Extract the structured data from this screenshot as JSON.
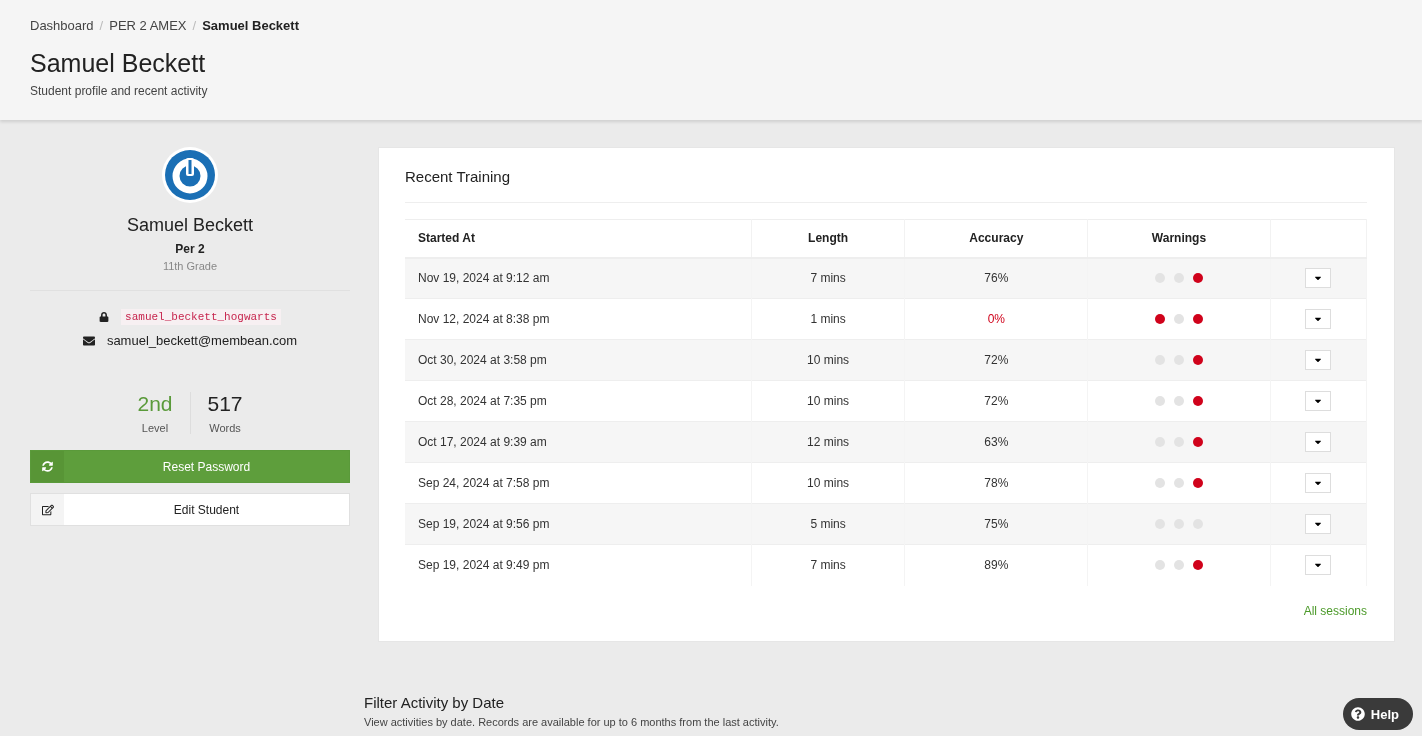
{
  "breadcrumb_separator": "/",
  "breadcrumb": [
    {
      "label": "Dashboard",
      "current": false
    },
    {
      "label": "PER 2 AMEX",
      "current": false
    },
    {
      "label": "Samuel Beckett",
      "current": true
    }
  ],
  "header": {
    "title": "Samuel Beckett",
    "subtitle": "Student profile and recent activity"
  },
  "profile": {
    "name": "Samuel Beckett",
    "class": "Per 2",
    "grade": "11th Grade",
    "username": "samuel_beckett_hogwarts",
    "email": "samuel_beckett@membean.com",
    "stats": [
      {
        "value": "2nd",
        "label": "Level",
        "highlight": true
      },
      {
        "value": "517",
        "label": "Words",
        "highlight": false
      }
    ],
    "buttons": [
      {
        "label": "Reset Password",
        "kind": "primary"
      },
      {
        "label": "Edit Student",
        "kind": "default"
      }
    ]
  },
  "training": {
    "title": "Recent Training",
    "columns": [
      "Started At",
      "Length",
      "Accuracy",
      "Warnings"
    ],
    "rows": [
      {
        "started": "Nov 19, 2024 at 9:12 am",
        "length": "7 mins",
        "accuracy": "76%",
        "low": false,
        "warnings": [
          false,
          false,
          true
        ]
      },
      {
        "started": "Nov 12, 2024 at 8:38 pm",
        "length": "1 mins",
        "accuracy": "0%",
        "low": true,
        "warnings": [
          true,
          false,
          true
        ]
      },
      {
        "started": "Oct 30, 2024 at 3:58 pm",
        "length": "10 mins",
        "accuracy": "72%",
        "low": false,
        "warnings": [
          false,
          false,
          true
        ]
      },
      {
        "started": "Oct 28, 2024 at 7:35 pm",
        "length": "10 mins",
        "accuracy": "72%",
        "low": false,
        "warnings": [
          false,
          false,
          true
        ]
      },
      {
        "started": "Oct 17, 2024 at 9:39 am",
        "length": "12 mins",
        "accuracy": "63%",
        "low": false,
        "warnings": [
          false,
          false,
          true
        ]
      },
      {
        "started": "Sep 24, 2024 at 7:58 pm",
        "length": "10 mins",
        "accuracy": "78%",
        "low": false,
        "warnings": [
          false,
          false,
          true
        ]
      },
      {
        "started": "Sep 19, 2024 at 9:56 pm",
        "length": "5 mins",
        "accuracy": "75%",
        "low": false,
        "warnings": [
          false,
          false,
          false
        ]
      },
      {
        "started": "Sep 19, 2024 at 9:49 pm",
        "length": "7 mins",
        "accuracy": "89%",
        "low": false,
        "warnings": [
          false,
          false,
          true
        ]
      }
    ],
    "link": "All sessions"
  },
  "filter": {
    "title": "Filter Activity by Date",
    "text": "View activities by date. Records are available for up to 6 months from the last activity."
  },
  "help": "Help"
}
